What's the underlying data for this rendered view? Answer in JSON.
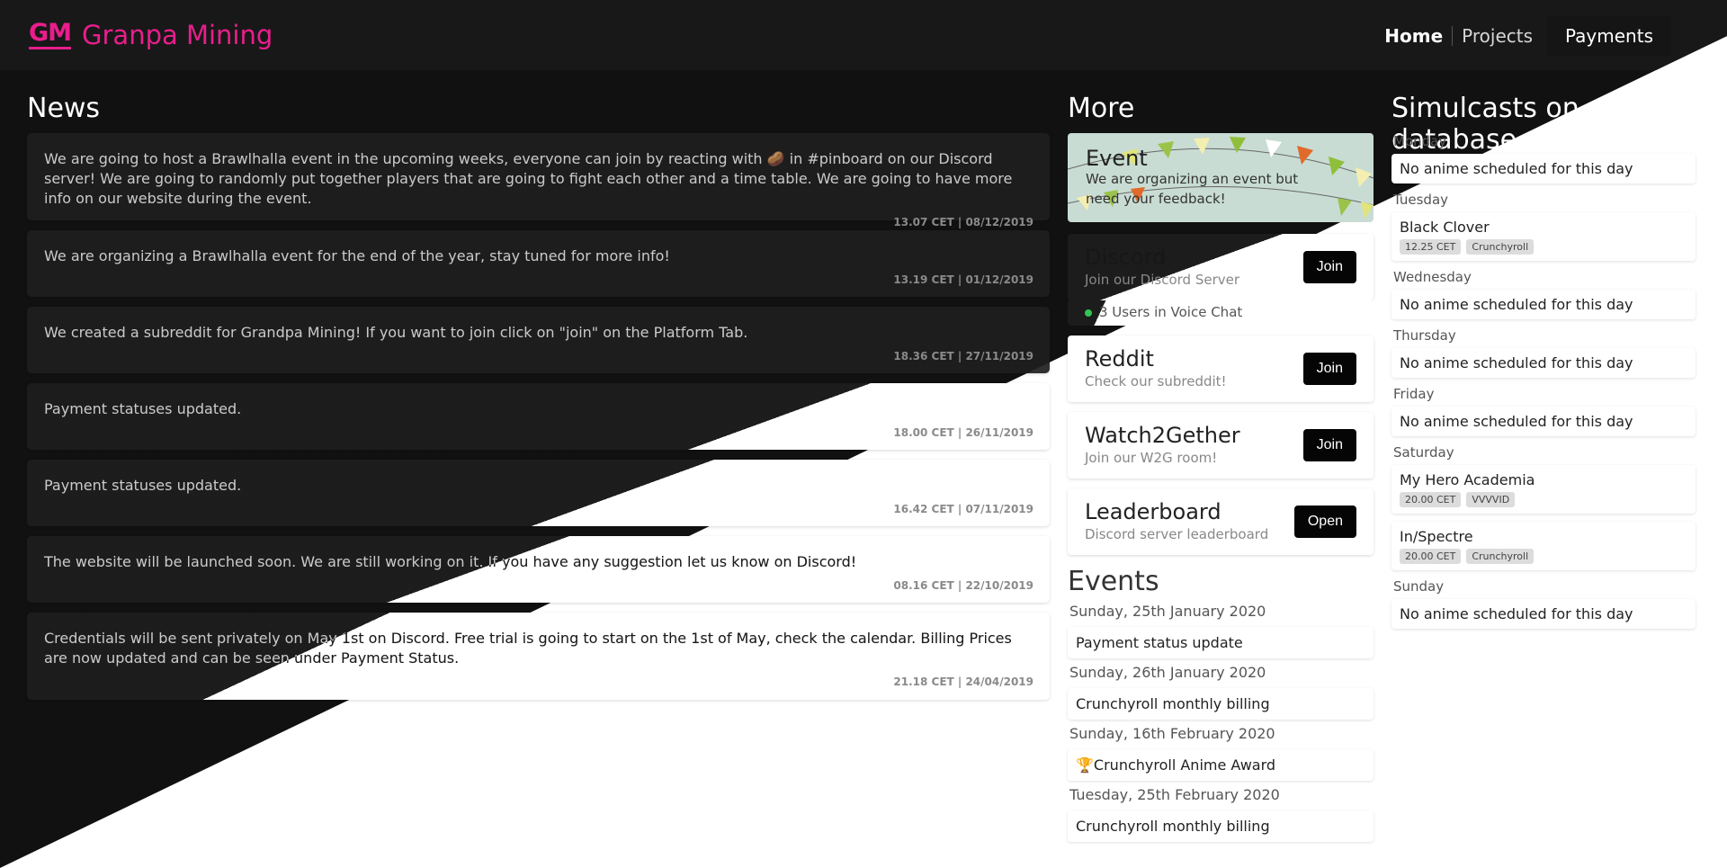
{
  "brand": {
    "mark": "GM",
    "name": "Granpa Mining",
    "color": "#e91e8c"
  },
  "nav": {
    "home": "Home",
    "projects": "Projects",
    "payments": "Payments"
  },
  "news": {
    "title": "News",
    "items": [
      {
        "text": "We are going to host a Brawlhalla event in the upcoming weeks, everyone can join by reacting with 🥔 in #pinboard on our Discord server! We are going to randomly put together players that are going to fight each other and a time table. We are going to have more info on our website during the event.",
        "time": "13.07 CET | 08/12/2019"
      },
      {
        "text": "We are organizing a Brawlhalla event for the end of the year, stay tuned for more info!",
        "time": "13.19 CET | 01/12/2019"
      },
      {
        "text": "We created a subreddit for Grandpa Mining! If you want to join click on \"join\" on the Platform Tab.",
        "time": "18.36 CET | 27/11/2019"
      },
      {
        "text": "Payment statuses updated.",
        "time": "18.00 CET | 26/11/2019"
      },
      {
        "text": "Payment statuses updated.",
        "time": "16.42 CET | 07/11/2019"
      },
      {
        "text": "The website will be launched soon. We are still working on it. If you have any suggestion let us know on Discord!",
        "time": "08.16 CET | 22/10/2019"
      },
      {
        "text": "Credentials will be sent privately on May 1st on Discord. Free trial is going to start on the 1st of May, check the calendar. Billing Prices are now updated and can be seen under Payment Status.",
        "time": "21.18 CET | 24/04/2019"
      }
    ]
  },
  "more": {
    "title": "More",
    "event": {
      "title": "Event",
      "desc": "We are organizing an event but need your feedback!"
    },
    "discord": {
      "title": "Discord",
      "sub": "Join our Discord Server",
      "button": "Join",
      "voice": "3 Users in Voice Chat"
    },
    "reddit": {
      "title": "Reddit",
      "sub": "Check our subreddit!",
      "button": "Join"
    },
    "watch2gether": {
      "title": "Watch2Gether",
      "sub": "Join our W2G room!",
      "button": "Join"
    },
    "leaderboard": {
      "title": "Leaderboard",
      "sub": "Discord server leaderboard",
      "button": "Open"
    }
  },
  "events": {
    "title": "Events",
    "items": [
      {
        "date": "Sunday, 25th January 2020",
        "label": "Payment status update"
      },
      {
        "date": "Sunday, 26th January 2020",
        "label": "Crunchyroll monthly billing"
      },
      {
        "date": "Sunday, 16th February 2020",
        "label": "🏆Crunchyroll Anime Award"
      },
      {
        "date": "Tuesday, 25th February 2020",
        "label": "Crunchyroll monthly billing"
      }
    ]
  },
  "simulcasts": {
    "title": "Simulcasts on our database",
    "days": [
      {
        "day": "Monday",
        "empty": "No anime scheduled for this day"
      },
      {
        "day": "Tuesday",
        "shows": [
          {
            "name": "Black Clover",
            "time": "12.25 CET",
            "source": "Crunchyroll"
          }
        ]
      },
      {
        "day": "Wednesday",
        "empty": "No anime scheduled for this day"
      },
      {
        "day": "Thursday",
        "empty": "No anime scheduled for this day"
      },
      {
        "day": "Friday",
        "empty": "No anime scheduled for this day"
      },
      {
        "day": "Saturday",
        "shows": [
          {
            "name": "My Hero Academia",
            "time": "20.00 CET",
            "source": "VVVVID"
          },
          {
            "name": "In/Spectre",
            "time": "20.00 CET",
            "source": "Crunchyroll"
          }
        ]
      },
      {
        "day": "Sunday",
        "empty": "No anime scheduled for this day"
      }
    ]
  }
}
